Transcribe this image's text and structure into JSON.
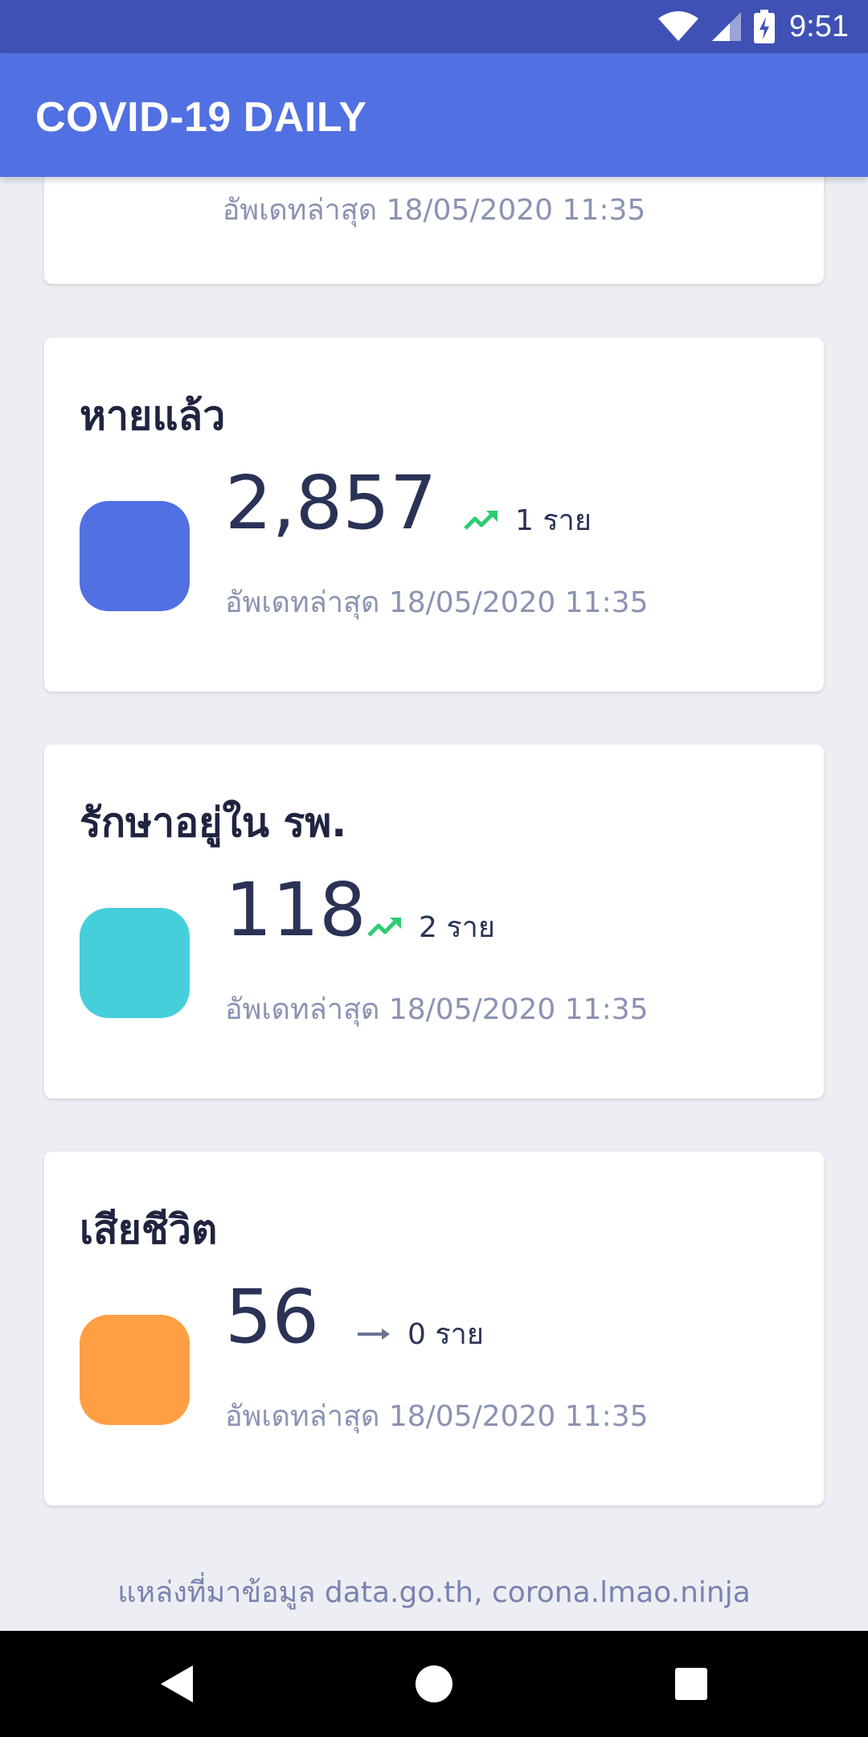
{
  "status_bar": {
    "time": "9:51"
  },
  "app_bar": {
    "title": "COVID-19 DAILY"
  },
  "top_card": {
    "updated": "อัพเดทล่าสุด 18/05/2020 11:35"
  },
  "cards": [
    {
      "title": "หายแล้ว",
      "value": "2,857",
      "change": "1 ราย",
      "trend": "up",
      "color": "#5170E2",
      "updated": "อัพเดทล่าสุด 18/05/2020 11:35"
    },
    {
      "title": "รักษาอยู่ใน รพ.",
      "value": "118",
      "change": "2 ราย",
      "trend": "up",
      "color": "#45CFDB",
      "updated": "อัพเดทล่าสุด 18/05/2020 11:35"
    },
    {
      "title": "เสียชีวิต",
      "value": "56",
      "change": "0 ราย",
      "trend": "flat",
      "color": "#FF9E43",
      "updated": "อัพเดทล่าสุด 18/05/2020 11:35"
    }
  ],
  "footer": {
    "source": "แหล่งที่มาข้อมูล data.go.th, corona.lmao.ninja"
  },
  "colors": {
    "status_bar": "#3F51B5",
    "app_bar": "#5170E2",
    "trend_up": "#2ECC71",
    "trend_flat": "#6B7494"
  },
  "icons": {
    "wifi": "wifi-icon",
    "signal": "cell-signal-icon",
    "battery": "battery-charging-icon",
    "trend_up": "trending-up-icon",
    "trend_flat": "arrow-right-icon",
    "back": "back-icon",
    "home": "home-icon",
    "recents": "recents-icon"
  }
}
